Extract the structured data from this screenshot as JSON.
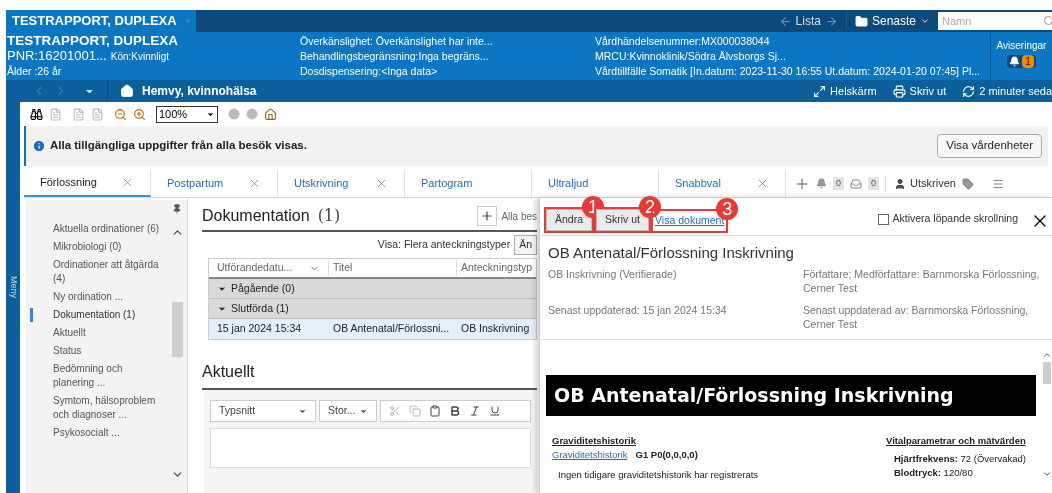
{
  "window_tab": {
    "title": "TESTRAPPORT, DUPLEXA"
  },
  "top_nav": {
    "list_label": "Lista",
    "recent_label": "Senaste",
    "search": {
      "placeholder": "Namn"
    }
  },
  "banner": {
    "name": "TESTRAPPORT, DUPLEXA",
    "pnr": "PNR:16201001...",
    "sex": "Kön:Kvinnligt",
    "age": "Ålder :26 år",
    "info_col_1": [
      "Överkänslighet: Överkänslighet har inte...",
      "Behandlingsbegränsning:Inga begräns...",
      "Dosdispensering:<Inga data>"
    ],
    "info_col_2": [
      "Vårdhändelsenummer:MX000038044",
      "MRCU:Kvinnoklinik/Södra Älvsborgs Sj...",
      "Vårdtillfälle Somatik [In.datum: 2023-11-30 16:55 Ut.datum: 2024-01-20 07:45] Pl..."
    ],
    "notifications": {
      "label": "Aviseringar",
      "count": "1"
    }
  },
  "nav_bar": {
    "title": "Hemvy, kvinnohälsa",
    "actions": [
      {
        "kind": "fullscreen",
        "label": "Helskärm"
      },
      {
        "kind": "print",
        "label": "Skriv ut"
      },
      {
        "kind": "refresh",
        "label": "2 minuter seda"
      }
    ]
  },
  "toolbar": {
    "zoom": "100%"
  },
  "info_banner": {
    "message": "Alla tillgängliga uppgifter från alla besök visas.",
    "button": "Visa vårdenheter"
  },
  "tabs": [
    {
      "label": "Förlossning",
      "selected": true,
      "closable": true
    },
    {
      "label": "Postpartum",
      "selected": false,
      "closable": true
    },
    {
      "label": "Utskrivning",
      "selected": false,
      "closable": true
    },
    {
      "label": "Partogram",
      "selected": false,
      "closable": false
    },
    {
      "label": "Ultraljud",
      "selected": false,
      "closable": false
    },
    {
      "label": "Snabbval",
      "selected": false,
      "closable": true
    }
  ],
  "tab_tools": {
    "alerts_count": "0",
    "inbox_count": "0",
    "status": "Utskriven"
  },
  "side_menu": {
    "label": "Meny"
  },
  "left_nav": {
    "items": [
      {
        "label": "Aktuella ordinationer (6)",
        "selected": false
      },
      {
        "label": "Mikrobiologi (0)",
        "selected": false
      },
      {
        "label": "Ordinationer att åtgärda (4)",
        "selected": false
      },
      {
        "label": "Ny ordination ...",
        "selected": false
      },
      {
        "label": "Dokumentation (1)",
        "selected": true
      },
      {
        "label": "Aktuellt",
        "selected": false
      },
      {
        "label": "Status",
        "selected": false
      },
      {
        "label": "Bedömning och planering ...",
        "selected": false
      },
      {
        "label": "Symtom, hälsoproblem och diagnoser ...",
        "selected": false
      },
      {
        "label": "Psykosocialt ...",
        "selected": false
      }
    ]
  },
  "documentation": {
    "title": "Dokumentation",
    "count": "(1)",
    "filter_label": "Alla bes",
    "view_label": "Visa: Flera anteckningstyper",
    "view_button": "Än",
    "columns": [
      "Utförandedatu...",
      "Titel",
      "Anteckningstyp"
    ],
    "groups": [
      {
        "label": "Pågående (0)",
        "expanded": true
      },
      {
        "label": "Slutförda (1)",
        "expanded": true,
        "rows": [
          {
            "cells": [
              "15 jan 2024 15:34",
              "OB Antenatal/Förlossni...",
              "OB Inskrivning"
            ],
            "selected": true
          }
        ]
      }
    ]
  },
  "current": {
    "title": "Aktuellt",
    "font_select": "Typsnitt",
    "size_select": "Stor..."
  },
  "document_panel": {
    "buttons": [
      {
        "label": "Ändra",
        "kind": "button",
        "highlighted": true,
        "callout": "1"
      },
      {
        "label": "Skriv ut",
        "kind": "button",
        "highlighted": true,
        "callout": "2"
      },
      {
        "label": "Visa dokument",
        "kind": "link",
        "highlighted": true,
        "callout": "3"
      }
    ],
    "scroll_option": {
      "label": "Aktivera löpande skrollning",
      "checked": false
    },
    "title": "OB Antenatal/Förlossning Inskrivning",
    "type": "OB Inskrivning (Verifierade)",
    "authors": "Författare; Medförfattare: Barnmorska Förlossning, Cerner Test",
    "updated": "Senast uppdaterad: 15 jan 2024 15:34",
    "updated_by": "Senast uppdaterad av: Barnmorska Förlossning, Cerner Test",
    "document": {
      "heading": "OB Antenatal/Förlossning Inskrivning",
      "left": {
        "heading": "Graviditetshistorik",
        "link": "Graviditetshistorik",
        "value": "G1 P0(0,0,0,0)",
        "note": "Ingen tidigare graviditetshistorik har registrerats"
      },
      "right": {
        "heading": "Vitalparametrar och mätvärden",
        "lines": [
          "**Hjärtfrekvens:** 72 (Övervakad)",
          "**Blodtryck:** 120/80"
        ]
      }
    }
  }
}
